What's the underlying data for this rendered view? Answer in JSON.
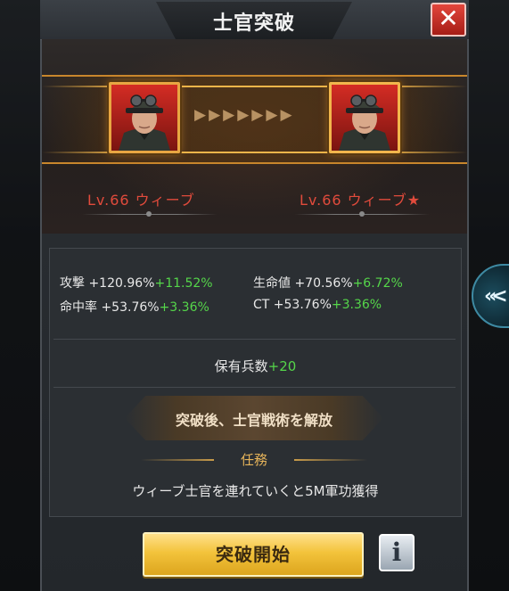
{
  "dialog": {
    "title": "士官突破",
    "close_symbol": "✕"
  },
  "officers": {
    "before": {
      "name": "Lv.66  ウィーブ"
    },
    "after": {
      "name": "Lv.66  ウィーブ★"
    },
    "arrow_glyphs": "▶▶▶▶▶▶▶"
  },
  "stats": {
    "attack": {
      "label": "攻撃",
      "value": "+120.96%",
      "bonus": "+11.52%"
    },
    "hp": {
      "label": "生命値",
      "value": "+70.56%",
      "bonus": "+6.72%"
    },
    "accuracy": {
      "label": "命中率",
      "value": "+53.76%",
      "bonus": "+3.36%"
    },
    "crit": {
      "label": "CT",
      "value": "+53.76%",
      "bonus": "+3.36%"
    }
  },
  "troops": {
    "label": "保有兵数",
    "bonus": "+20"
  },
  "unlock_text": "突破後、士官戦術を解放",
  "mission": {
    "title": "任務",
    "text": "ウィーブ士官を連れていくと5M軍功獲得"
  },
  "buttons": {
    "start": "突破開始",
    "info": "i"
  },
  "side_tab": {
    "glyph": "«<"
  },
  "colors": {
    "bonus_green": "#55d64a",
    "name_red": "#e14b3c",
    "gold": "#f3c33b",
    "close_red": "#c8322a"
  }
}
